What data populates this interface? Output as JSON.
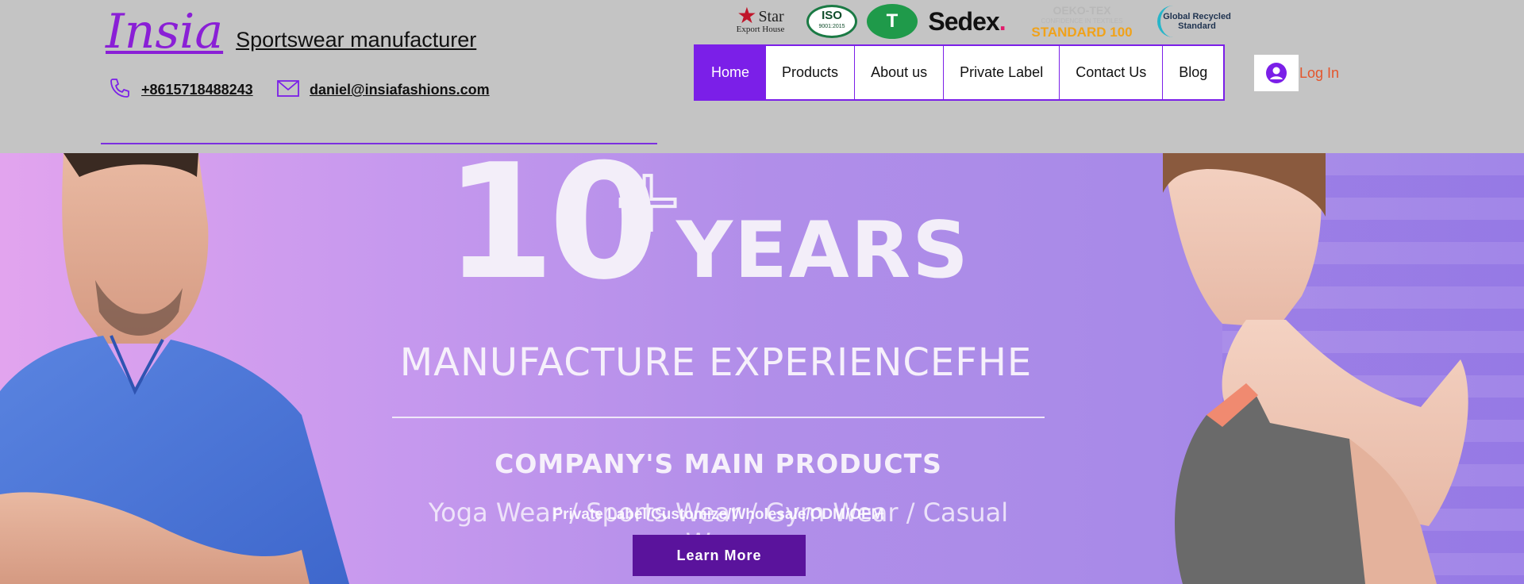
{
  "brand": {
    "logo": "Insia",
    "tagline": "Sportswear manufacturer"
  },
  "contact": {
    "phone": "+8615718488243",
    "email": "daniel@insiafashions.com"
  },
  "certifications": {
    "star": {
      "line1": "Star",
      "line2": "Export House"
    },
    "iso": {
      "label": "ISO",
      "sub": "9001:2015"
    },
    "gots": {
      "label": "T"
    },
    "sedex": {
      "label": "Sedex",
      "dot": "."
    },
    "oeko": {
      "line1": "OEKO-TEX",
      "line2": "CONFIDENCE IN TEXTILES",
      "line3": "STANDARD 100"
    },
    "grs": {
      "line1": "Global Recycled",
      "line2": "Standard"
    }
  },
  "nav": {
    "items": [
      {
        "label": "Home",
        "active": true
      },
      {
        "label": "Products",
        "active": false
      },
      {
        "label": "About us",
        "active": false
      },
      {
        "label": "Private Label",
        "active": false
      },
      {
        "label": "Contact Us",
        "active": false
      },
      {
        "label": "Blog",
        "active": false
      }
    ]
  },
  "login": {
    "label": "Log In"
  },
  "hero": {
    "years_number": "10",
    "years_plus": "+",
    "years_word": "YEARS",
    "experience": "MANUFACTURE EXPERIENCEFHE",
    "main_products": "COMPANY'S MAIN PRODUCTS",
    "subline_a": "Yoga Wear / Sports Wear / Gym Wear / Casual Wear",
    "subline_b": "Private Label/Customize/Wholesale/ODM/OEM",
    "cta": "Learn More"
  },
  "colors": {
    "accent": "#7b1fe8",
    "logo": "#8a1fd6",
    "header_bg": "#c4c4c4",
    "login_text": "#e4552c",
    "cta_bg": "#5a139c"
  }
}
